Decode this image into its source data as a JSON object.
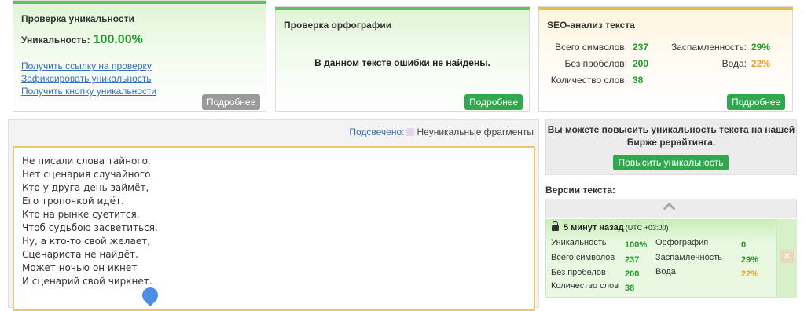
{
  "uniqueness_panel": {
    "title_prefix": "Проверка",
    "title_bold": "уникальности",
    "uniqueness_label": "Уникальность:",
    "uniqueness_value": "100.00%",
    "links": [
      "Получить ссылку на проверку",
      "Зафиксировать уникальность",
      "Получить кнопку уникальности"
    ],
    "more_button": "Подробнее"
  },
  "spelling_panel": {
    "title": "Проверка орфографии",
    "message": "В данном тексте ошибки не найдены.",
    "more_button": "Подробнее"
  },
  "seo_panel": {
    "title": "SEO-анализ текста",
    "stats": {
      "total_chars_label": "Всего символов:",
      "total_chars": "237",
      "no_spaces_label": "Без пробелов:",
      "no_spaces": "200",
      "word_count_label": "Количество слов:",
      "word_count": "38",
      "spam_label": "Заспамленность:",
      "spam": "29%",
      "water_label": "Вода:",
      "water": "22%"
    },
    "more_button": "Подробнее"
  },
  "editor": {
    "highlight_label": "Подсвечено:",
    "highlight_legend": "Неуникальные фрагменты",
    "lines": [
      "Не писали слова тайного.",
      "Нет сценария случайного.",
      "Кто у друга день займёт,",
      "Его тропочкой идёт.",
      "Кто на рынке суетится,",
      "Чтоб судьбою засветиться.",
      "Ну, а кто-то свой желает,",
      "Сценариста не найдёт.",
      "Может ночью он икнет",
      "И сценарий свой чиркнет."
    ]
  },
  "promo": {
    "text": "Вы можете повысить уникальность текста на нашей Бирже рерайтинга.",
    "button": "Повысить уникальность"
  },
  "versions": {
    "title": "Версии текста:",
    "item": {
      "time": "5 минут назад",
      "timezone": "(UTC +03:00)",
      "uniq_label": "Уникальность",
      "uniq": "100%",
      "spelling_label": "Орфография",
      "spelling": "0",
      "total_label": "Всего символов",
      "total": "237",
      "spam_label": "Заспамленность",
      "spam": "29%",
      "nospace_label": "Без пробелов",
      "nospace": "200",
      "water_label": "Вода",
      "water": "22%",
      "words_label": "Количество слов",
      "words": "38"
    },
    "close_symbol": "✕"
  },
  "colors": {
    "accent_green": "#2fa84f",
    "value_green": "#1f9b27",
    "warning_orange": "#f0a020",
    "link_blue": "#3a6fb0",
    "seo_topbar": "#f0b947"
  }
}
